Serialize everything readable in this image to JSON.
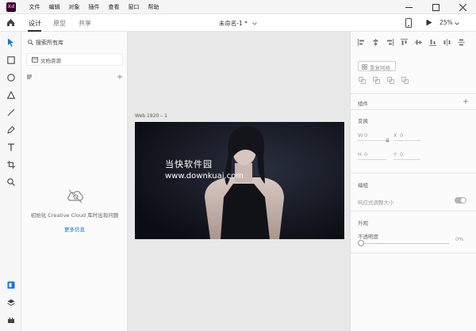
{
  "menu": {
    "logo": "Xd",
    "items": [
      "文件",
      "编辑",
      "对象",
      "插件",
      "查看",
      "窗口",
      "帮助"
    ]
  },
  "toolbar": {
    "tabs": [
      {
        "label": "设计",
        "active": true
      },
      {
        "label": "原型",
        "active": false
      },
      {
        "label": "共享",
        "active": false
      }
    ],
    "doc_title": "未命名-1 *",
    "zoom": "25%"
  },
  "left_panel": {
    "search_placeholder": "搜索所有库",
    "doc_assets": "文档资源",
    "empty_message": "初始化 Creative Cloud 库时出现问题",
    "more_link": "更多信息"
  },
  "canvas": {
    "artboard_label": "Web 1920 – 1",
    "watermark_cn": "当快软件园",
    "watermark_url": "www.downkuai.com"
  },
  "right_panel": {
    "repeat_grid": "重复网格",
    "components_label": "组件",
    "transform_label": "变换",
    "fields": {
      "w_label": "W",
      "w_value": "0",
      "x_label": "X",
      "x_value": "0",
      "h_label": "H",
      "h_value": "0",
      "y_label": "Y",
      "y_value": "0"
    },
    "layout_label": "编组",
    "responsive_label": "响应式调整大小",
    "appearance_label": "外观",
    "opacity_label": "不透明度",
    "opacity_value": "0%"
  },
  "colors": {
    "accent": "#1473e6",
    "selected_tool": "#1473e6",
    "logo_bg": "#2e001f",
    "logo_fg": "#ff61f6"
  }
}
